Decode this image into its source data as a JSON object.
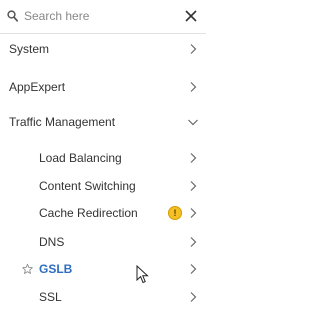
{
  "search": {
    "placeholder": "Search here"
  },
  "nav": {
    "system": "System",
    "appexpert": "AppExpert",
    "traffic_management": "Traffic Management",
    "children": {
      "load_balancing": "Load Balancing",
      "content_switching": "Content Switching",
      "cache_redirection": "Cache Redirection",
      "dns": "DNS",
      "gslb": "GSLB",
      "ssl": "SSL"
    },
    "cache_redirection_badge": "!"
  },
  "colors": {
    "selected_text": "#2e6dbf",
    "warning_badge": "#f5c023"
  },
  "state": {
    "expanded": "Traffic Management",
    "selected": "GSLB"
  }
}
